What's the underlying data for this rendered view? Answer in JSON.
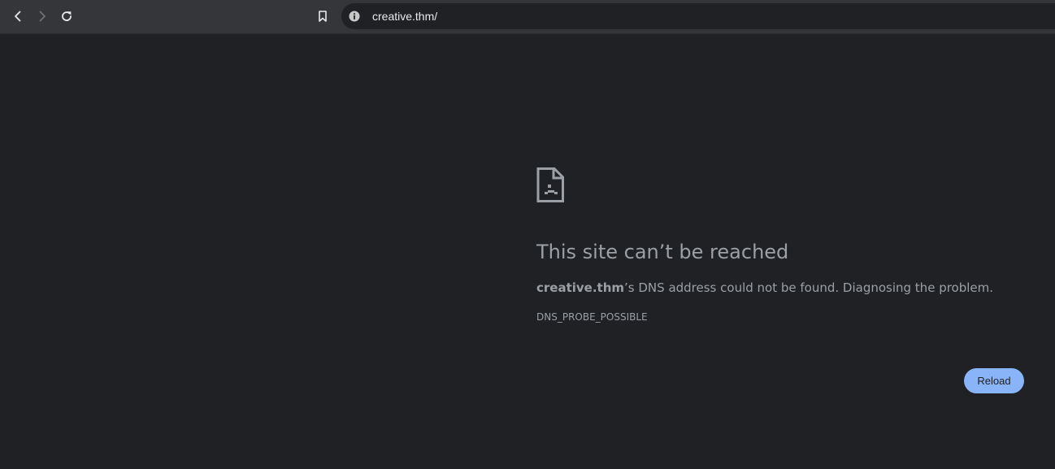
{
  "browser": {
    "url": "creative.thm/",
    "icons": {
      "back": "back-arrow-icon",
      "forward": "forward-arrow-icon",
      "reload": "reload-icon",
      "bookmark": "bookmark-icon",
      "site_info": "info-icon"
    }
  },
  "error_page": {
    "icon": "sad-document-icon",
    "title": "This site can’t be reached",
    "host": "creative.thm",
    "message_rest": "’s DNS address could not be found. Diagnosing the problem.",
    "error_code": "DNS_PROBE_POSSIBLE",
    "reload_label": "Reload"
  },
  "colors": {
    "page_background": "#202124",
    "toolbar_background": "#35363a",
    "text_secondary": "#9aa0a6",
    "button_accent": "#8ab4f8"
  }
}
